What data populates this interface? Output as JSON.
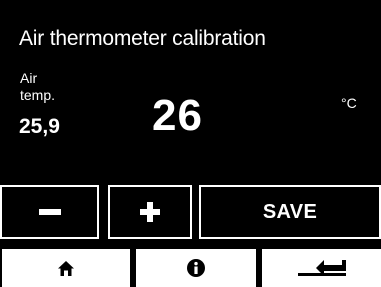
{
  "header": {
    "title": "Air thermometer calibration"
  },
  "reading": {
    "label_line1": "Air",
    "label_line2": "temp.",
    "current_value": "25,9",
    "target_value": "26",
    "unit": "°C"
  },
  "controls": {
    "minus_icon": "minus-icon",
    "plus_icon": "plus-icon",
    "save_label": "SAVE"
  },
  "nav": {
    "home_icon": "home-icon",
    "info_icon": "info-icon",
    "back_icon": "back-arrow-icon"
  },
  "colors": {
    "background": "#000000",
    "foreground": "#ffffff"
  }
}
